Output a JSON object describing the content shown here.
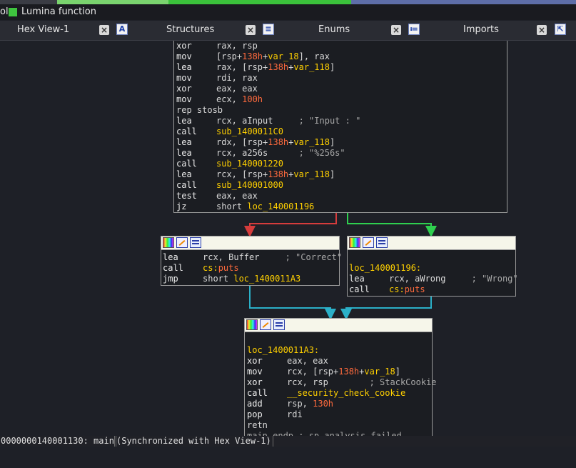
{
  "colors": {
    "legend_lumina": "#3fc43f",
    "top_strip": [
      "#7ad36e",
      "#3bc23b",
      "#5e6ea8"
    ],
    "edge_false": "#d63c3c",
    "edge_true": "#2fcf4f",
    "edge_jump": "#2bb0c8"
  },
  "legend": {
    "prefix": "ol",
    "lumina": "Lumina function"
  },
  "tabs": [
    {
      "label": "Hex View-1",
      "icon": "hex-view-icon"
    },
    {
      "label": "Structures",
      "icon": "structures-icon"
    },
    {
      "label": "Enums",
      "icon": "enums-icon"
    },
    {
      "label": "Imports",
      "icon": "imports-icon"
    }
  ],
  "blocks": {
    "main": [
      [
        {
          "t": "xor",
          "c": "m"
        },
        {
          "t": "rax, rsp",
          "c": "o"
        }
      ],
      [
        {
          "t": "mov",
          "c": "m"
        },
        {
          "t": "[rsp+",
          "c": "o"
        },
        {
          "t": "138h",
          "c": "k"
        },
        {
          "t": "+",
          "c": "o"
        },
        {
          "t": "var_18",
          "c": "n"
        },
        {
          "t": "], rax",
          "c": "o"
        }
      ],
      [
        {
          "t": "lea",
          "c": "m"
        },
        {
          "t": "rax, [rsp+",
          "c": "o"
        },
        {
          "t": "138h",
          "c": "k"
        },
        {
          "t": "+",
          "c": "o"
        },
        {
          "t": "var_118",
          "c": "n"
        },
        {
          "t": "]",
          "c": "o"
        }
      ],
      [
        {
          "t": "mov",
          "c": "m"
        },
        {
          "t": "rdi, rax",
          "c": "o"
        }
      ],
      [
        {
          "t": "xor",
          "c": "m"
        },
        {
          "t": "eax, eax",
          "c": "o"
        }
      ],
      [
        {
          "t": "mov",
          "c": "m"
        },
        {
          "t": "ecx, ",
          "c": "o"
        },
        {
          "t": "100h",
          "c": "k"
        }
      ],
      [
        {
          "t": "rep stosb",
          "c": "o"
        }
      ],
      [
        {
          "t": "lea",
          "c": "m"
        },
        {
          "t": "rcx, aInput     ",
          "c": "o"
        },
        {
          "t": "; \"Input : \"",
          "c": "c"
        }
      ],
      [
        {
          "t": "call",
          "c": "m"
        },
        {
          "t": "sub_1400011C0",
          "c": "n"
        }
      ],
      [
        {
          "t": "lea",
          "c": "m"
        },
        {
          "t": "rdx, [rsp+",
          "c": "o"
        },
        {
          "t": "138h",
          "c": "k"
        },
        {
          "t": "+",
          "c": "o"
        },
        {
          "t": "var_118",
          "c": "n"
        },
        {
          "t": "]",
          "c": "o"
        }
      ],
      [
        {
          "t": "lea",
          "c": "m"
        },
        {
          "t": "rcx, a256s      ",
          "c": "o"
        },
        {
          "t": "; \"%256s\"",
          "c": "c"
        }
      ],
      [
        {
          "t": "call",
          "c": "m"
        },
        {
          "t": "sub_140001220",
          "c": "n"
        }
      ],
      [
        {
          "t": "lea",
          "c": "m"
        },
        {
          "t": "rcx, [rsp+",
          "c": "o"
        },
        {
          "t": "138h",
          "c": "k"
        },
        {
          "t": "+",
          "c": "o"
        },
        {
          "t": "var_118",
          "c": "n"
        },
        {
          "t": "]",
          "c": "o"
        }
      ],
      [
        {
          "t": "call",
          "c": "m"
        },
        {
          "t": "sub_140001000",
          "c": "n"
        }
      ],
      [
        {
          "t": "test",
          "c": "m"
        },
        {
          "t": "eax, eax",
          "c": "o"
        }
      ],
      [
        {
          "t": "jz",
          "c": "m"
        },
        {
          "t": "short ",
          "c": "o"
        },
        {
          "t": "loc_140001196",
          "c": "n"
        }
      ]
    ],
    "correct": [
      [
        {
          "t": "lea",
          "c": "m"
        },
        {
          "t": "rcx, Buffer     ",
          "c": "o"
        },
        {
          "t": "; \"Correct\"",
          "c": "c"
        }
      ],
      [
        {
          "t": "call",
          "c": "m"
        },
        {
          "t": "cs:",
          "c": "n"
        },
        {
          "t": "puts",
          "c": "k"
        }
      ],
      [
        {
          "t": "jmp",
          "c": "m"
        },
        {
          "t": "short ",
          "c": "o"
        },
        {
          "t": "loc_1400011A3",
          "c": "n"
        }
      ]
    ],
    "wrong": [
      [],
      [
        {
          "t": "loc_140001196:",
          "c": "n"
        }
      ],
      [
        {
          "t": "lea",
          "c": "m"
        },
        {
          "t": "rcx, aWrong     ",
          "c": "o"
        },
        {
          "t": "; \"Wrong\"",
          "c": "c"
        }
      ],
      [
        {
          "t": "call",
          "c": "m"
        },
        {
          "t": "cs:",
          "c": "n"
        },
        {
          "t": "puts",
          "c": "k"
        }
      ]
    ],
    "end": [
      [],
      [
        {
          "t": "loc_1400011A3:",
          "c": "n"
        }
      ],
      [
        {
          "t": "xor",
          "c": "m"
        },
        {
          "t": "eax, eax",
          "c": "o"
        }
      ],
      [
        {
          "t": "mov",
          "c": "m"
        },
        {
          "t": "rcx, [rsp+",
          "c": "o"
        },
        {
          "t": "138h",
          "c": "k"
        },
        {
          "t": "+",
          "c": "o"
        },
        {
          "t": "var_18",
          "c": "n"
        },
        {
          "t": "]",
          "c": "o"
        }
      ],
      [
        {
          "t": "xor",
          "c": "m"
        },
        {
          "t": "rcx, rsp        ",
          "c": "o"
        },
        {
          "t": "; StackCookie",
          "c": "c"
        }
      ],
      [
        {
          "t": "call",
          "c": "m"
        },
        {
          "t": "__security_check_cookie",
          "c": "n"
        }
      ],
      [
        {
          "t": "add",
          "c": "m"
        },
        {
          "t": "rsp, ",
          "c": "o"
        },
        {
          "t": "130h",
          "c": "k"
        }
      ],
      [
        {
          "t": "pop",
          "c": "m"
        },
        {
          "t": "rdi",
          "c": "o"
        }
      ],
      [
        {
          "t": "retn",
          "c": "o"
        }
      ],
      [
        {
          "t": "main endp ; sp-analysis failed",
          "c": "c"
        }
      ]
    ]
  },
  "status": {
    "address": "0000000140001130: main",
    "sync": "(Synchronized with Hex View-1)"
  }
}
